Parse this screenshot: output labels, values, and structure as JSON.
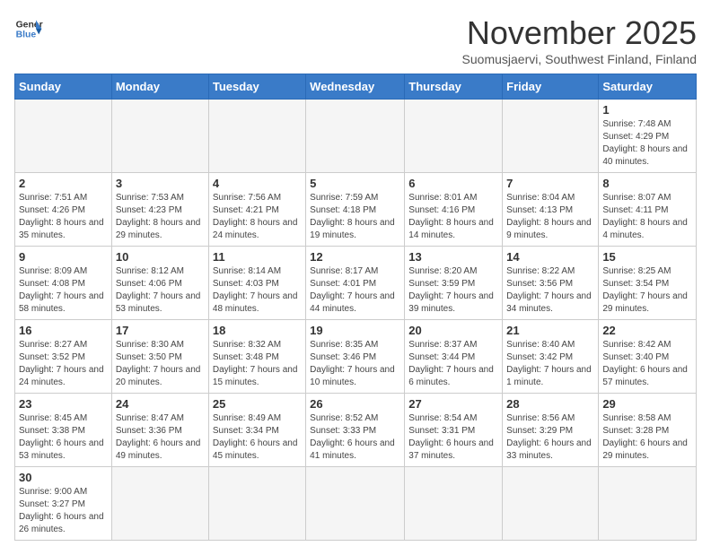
{
  "header": {
    "logo_line1": "General",
    "logo_line2": "Blue",
    "month": "November 2025",
    "location": "Suomusjaervi, Southwest Finland, Finland"
  },
  "weekdays": [
    "Sunday",
    "Monday",
    "Tuesday",
    "Wednesday",
    "Thursday",
    "Friday",
    "Saturday"
  ],
  "weeks": [
    [
      {
        "day": "",
        "info": ""
      },
      {
        "day": "",
        "info": ""
      },
      {
        "day": "",
        "info": ""
      },
      {
        "day": "",
        "info": ""
      },
      {
        "day": "",
        "info": ""
      },
      {
        "day": "",
        "info": ""
      },
      {
        "day": "1",
        "info": "Sunrise: 7:48 AM\nSunset: 4:29 PM\nDaylight: 8 hours and 40 minutes."
      }
    ],
    [
      {
        "day": "2",
        "info": "Sunrise: 7:51 AM\nSunset: 4:26 PM\nDaylight: 8 hours and 35 minutes."
      },
      {
        "day": "3",
        "info": "Sunrise: 7:53 AM\nSunset: 4:23 PM\nDaylight: 8 hours and 29 minutes."
      },
      {
        "day": "4",
        "info": "Sunrise: 7:56 AM\nSunset: 4:21 PM\nDaylight: 8 hours and 24 minutes."
      },
      {
        "day": "5",
        "info": "Sunrise: 7:59 AM\nSunset: 4:18 PM\nDaylight: 8 hours and 19 minutes."
      },
      {
        "day": "6",
        "info": "Sunrise: 8:01 AM\nSunset: 4:16 PM\nDaylight: 8 hours and 14 minutes."
      },
      {
        "day": "7",
        "info": "Sunrise: 8:04 AM\nSunset: 4:13 PM\nDaylight: 8 hours and 9 minutes."
      },
      {
        "day": "8",
        "info": "Sunrise: 8:07 AM\nSunset: 4:11 PM\nDaylight: 8 hours and 4 minutes."
      }
    ],
    [
      {
        "day": "9",
        "info": "Sunrise: 8:09 AM\nSunset: 4:08 PM\nDaylight: 7 hours and 58 minutes."
      },
      {
        "day": "10",
        "info": "Sunrise: 8:12 AM\nSunset: 4:06 PM\nDaylight: 7 hours and 53 minutes."
      },
      {
        "day": "11",
        "info": "Sunrise: 8:14 AM\nSunset: 4:03 PM\nDaylight: 7 hours and 48 minutes."
      },
      {
        "day": "12",
        "info": "Sunrise: 8:17 AM\nSunset: 4:01 PM\nDaylight: 7 hours and 44 minutes."
      },
      {
        "day": "13",
        "info": "Sunrise: 8:20 AM\nSunset: 3:59 PM\nDaylight: 7 hours and 39 minutes."
      },
      {
        "day": "14",
        "info": "Sunrise: 8:22 AM\nSunset: 3:56 PM\nDaylight: 7 hours and 34 minutes."
      },
      {
        "day": "15",
        "info": "Sunrise: 8:25 AM\nSunset: 3:54 PM\nDaylight: 7 hours and 29 minutes."
      }
    ],
    [
      {
        "day": "16",
        "info": "Sunrise: 8:27 AM\nSunset: 3:52 PM\nDaylight: 7 hours and 24 minutes."
      },
      {
        "day": "17",
        "info": "Sunrise: 8:30 AM\nSunset: 3:50 PM\nDaylight: 7 hours and 20 minutes."
      },
      {
        "day": "18",
        "info": "Sunrise: 8:32 AM\nSunset: 3:48 PM\nDaylight: 7 hours and 15 minutes."
      },
      {
        "day": "19",
        "info": "Sunrise: 8:35 AM\nSunset: 3:46 PM\nDaylight: 7 hours and 10 minutes."
      },
      {
        "day": "20",
        "info": "Sunrise: 8:37 AM\nSunset: 3:44 PM\nDaylight: 7 hours and 6 minutes."
      },
      {
        "day": "21",
        "info": "Sunrise: 8:40 AM\nSunset: 3:42 PM\nDaylight: 7 hours and 1 minute."
      },
      {
        "day": "22",
        "info": "Sunrise: 8:42 AM\nSunset: 3:40 PM\nDaylight: 6 hours and 57 minutes."
      }
    ],
    [
      {
        "day": "23",
        "info": "Sunrise: 8:45 AM\nSunset: 3:38 PM\nDaylight: 6 hours and 53 minutes."
      },
      {
        "day": "24",
        "info": "Sunrise: 8:47 AM\nSunset: 3:36 PM\nDaylight: 6 hours and 49 minutes."
      },
      {
        "day": "25",
        "info": "Sunrise: 8:49 AM\nSunset: 3:34 PM\nDaylight: 6 hours and 45 minutes."
      },
      {
        "day": "26",
        "info": "Sunrise: 8:52 AM\nSunset: 3:33 PM\nDaylight: 6 hours and 41 minutes."
      },
      {
        "day": "27",
        "info": "Sunrise: 8:54 AM\nSunset: 3:31 PM\nDaylight: 6 hours and 37 minutes."
      },
      {
        "day": "28",
        "info": "Sunrise: 8:56 AM\nSunset: 3:29 PM\nDaylight: 6 hours and 33 minutes."
      },
      {
        "day": "29",
        "info": "Sunrise: 8:58 AM\nSunset: 3:28 PM\nDaylight: 6 hours and 29 minutes."
      }
    ],
    [
      {
        "day": "30",
        "info": "Sunrise: 9:00 AM\nSunset: 3:27 PM\nDaylight: 6 hours and 26 minutes."
      },
      {
        "day": "",
        "info": ""
      },
      {
        "day": "",
        "info": ""
      },
      {
        "day": "",
        "info": ""
      },
      {
        "day": "",
        "info": ""
      },
      {
        "day": "",
        "info": ""
      },
      {
        "day": "",
        "info": ""
      }
    ]
  ]
}
